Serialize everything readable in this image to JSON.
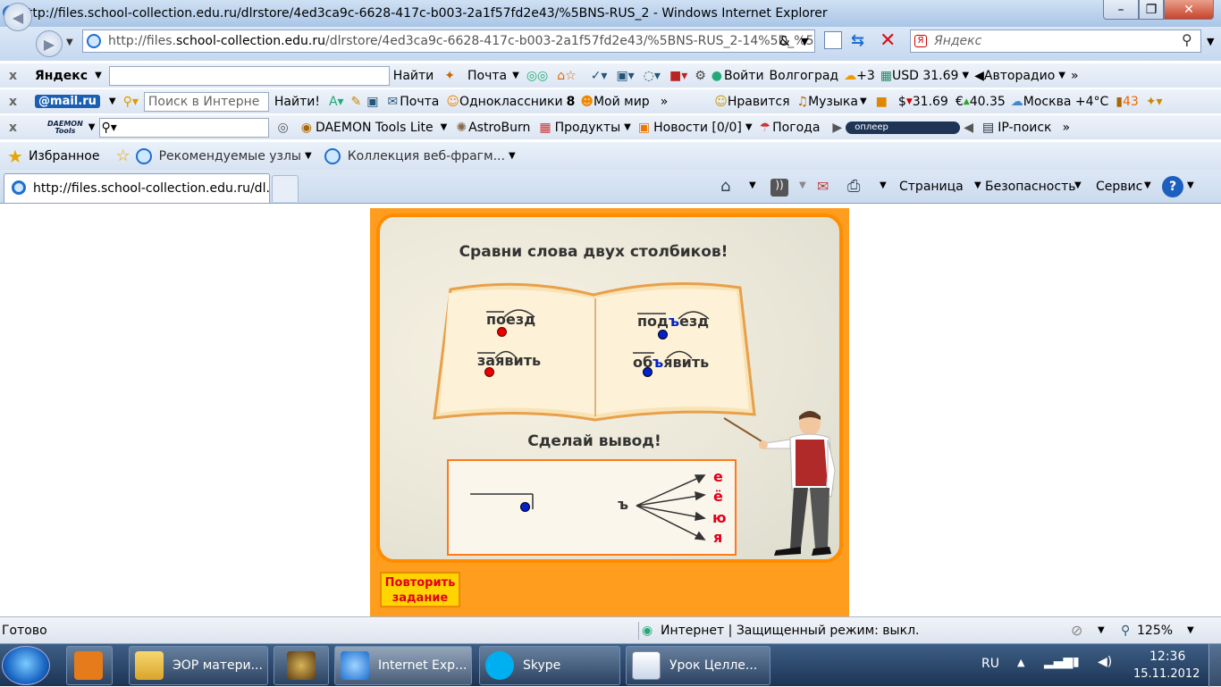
{
  "window": {
    "title": "http://files.school-collection.edu.ru/dlrstore/4ed3ca9c-6628-417c-b003-2a1f57fd2e43/%5BNS-RUS_2 - Windows Internet Explorer",
    "minimize": "–",
    "maximize": "❐",
    "close": "✕"
  },
  "nav": {
    "address_prefix": "http://files.",
    "address_host": "school-collection.edu.ru",
    "address_rest": "/dlrstore/4ed3ca9c-6628-417c-b003-2a1f57fd2e43/%5BNS-RUS_2-14%5D_%5",
    "address_tail": "&",
    "search_placeholder": "Яндекс"
  },
  "yandex_bar": {
    "brand": "Яндекс",
    "find": "Найти",
    "mail": "Почта",
    "login": "Войти",
    "city": "Волгоград",
    "weather": "+3",
    "usd": "USD 31.69",
    "radio": "Авторадио"
  },
  "mailru_bar": {
    "brand": "@mail.ru",
    "search_placeholder": "Поиск в Интерне",
    "find": "Найти!",
    "mail": "Почта",
    "ok": "Одноклассники",
    "ok_count": "8",
    "myworld": "Мой мир",
    "like": "Нравится",
    "music": "Музыка",
    "usd": "$",
    "usd_val": "31.69",
    "eur": "€",
    "eur_val": "40.35",
    "weather": "Москва +4°C",
    "traffic": "43"
  },
  "daemon_bar": {
    "brand_top": "DAEMON",
    "brand_bottom": "Tools",
    "lite": "DAEMON Tools Lite",
    "astro": "AstroBurn",
    "products": "Продукты",
    "news": "Новости [0/0]",
    "weather": "Погода",
    "player": "оплеер",
    "ip": "IP-поиск"
  },
  "favorites": {
    "label": "Избранное",
    "recommended": "Рекомендуемые узлы",
    "collection": "Коллекция веб-фрагм..."
  },
  "tab": {
    "title": "http://files.school-collection.edu.ru/dl..."
  },
  "command_bar": {
    "page": "Страница",
    "safety": "Безопасность",
    "service": "Сервис"
  },
  "lesson": {
    "title": "Сравни слова двух столбиков!",
    "left_words": [
      "поезд",
      "заявить"
    ],
    "right_word1_a": "под",
    "right_word1_b": "ъ",
    "right_word1_c": "езд",
    "right_word2_a": "об",
    "right_word2_b": "ъ",
    "right_word2_c": "явить",
    "conclusion": "Сделай вывод!",
    "sign": "ъ",
    "vowels": [
      "е",
      "ё",
      "ю",
      "я"
    ],
    "repeat_line1": "Повторить",
    "repeat_line2": "задание",
    "colors": {
      "orange": "#ff9d1e",
      "red": "#e60000",
      "blue": "#0022cc"
    }
  },
  "status": {
    "ready": "Готово",
    "zone": "Интернет | Защищенный режим: выкл.",
    "zoom": "125%"
  },
  "taskbar": {
    "items": [
      "ЭОР матери...",
      "Internet Exp...",
      "Skype",
      "Урок Целле..."
    ],
    "lang": "RU",
    "time": "12:36",
    "date": "15.11.2012"
  }
}
